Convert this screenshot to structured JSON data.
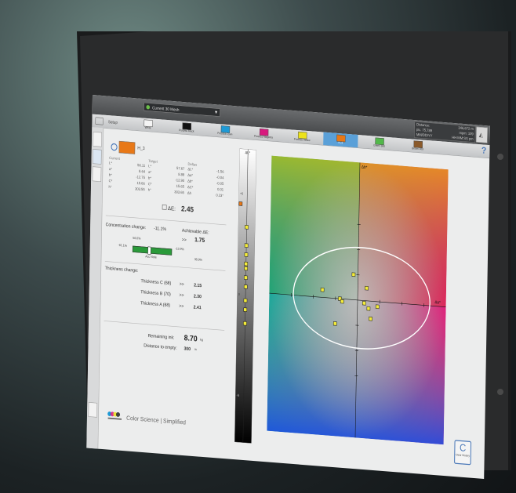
{
  "toolbar": {
    "combo_value": "Current 30 Mesh",
    "setup_label": "Setup",
    "distance_rows": [
      {
        "label": "Distance:",
        "value": "346,672 m"
      },
      {
        "label": "pic. 75,789",
        "value": "mpm: 109"
      },
      {
        "label": "MM/DD/YY",
        "value": "HH:MM:SS pm"
      }
    ]
  },
  "colorTabs": [
    {
      "label": "White",
      "color": "#f4f4f4"
    },
    {
      "label": "Process Black",
      "color": "#111111"
    },
    {
      "label": "Process Cyan",
      "color": "#1e9ad6"
    },
    {
      "label": "Process Magenta",
      "color": "#d8197e"
    },
    {
      "label": "Process Yellow",
      "color": "#ece21a"
    },
    {
      "label": "H_3",
      "color": "#e87817",
      "active": true
    },
    {
      "label": "Green 368",
      "color": "#52b84a"
    },
    {
      "label": "Brown 469",
      "color": "#8b5a2b"
    }
  ],
  "sample": {
    "name": "H_3",
    "color": "#e87817",
    "headers": [
      "Current",
      "Target",
      "Deltas"
    ],
    "current": [
      {
        "k": "L*",
        "v": "56.11"
      },
      {
        "k": "a*",
        "v": "8.64"
      },
      {
        "k": "b*",
        "v": "-12.75"
      },
      {
        "k": "C*",
        "v": "15.66"
      },
      {
        "k": "h°",
        "v": "303.55"
      }
    ],
    "target": [
      {
        "k": "L*",
        "v": "57.67"
      },
      {
        "k": "a*",
        "v": "8.88"
      },
      {
        "k": "b*",
        "v": "-12.90"
      },
      {
        "k": "C*",
        "v": "15.65"
      },
      {
        "k": "h°",
        "v": "303.65"
      }
    ],
    "deltas": [
      {
        "k": "ΔL*",
        "v": "-1.56"
      },
      {
        "k": "Δa*",
        "v": "-0.04"
      },
      {
        "k": "Δb*",
        "v": "-0.05"
      },
      {
        "k": "ΔC*",
        "v": "0.01"
      },
      {
        "k": "Δh",
        "v": "0.23°"
      }
    ],
    "delta_e_label": "ΔE:",
    "delta_e_value": "2.45"
  },
  "concentration": {
    "label": "Concentration change:",
    "value": "-11.1%",
    "achievable_label": "Achievable ΔE:",
    "achievable_value": "1.75",
    "arrow": ">>",
    "left_pct": "-61.1%",
    "mid_pct": "56.0%",
    "right_pct": "-13.9%",
    "far_pct": "38.9%",
    "bar_caption": "Acc Note",
    "fill_fraction": 0.42
  },
  "thickness": {
    "label": "Thickness change:",
    "arrow": ">>",
    "rows": [
      {
        "name": "Thickness C (68)",
        "value": "2.15"
      },
      {
        "name": "Thickness B (70)",
        "value": "2.30"
      },
      {
        "name": "Thickness A (68)",
        "value": "2.41"
      }
    ]
  },
  "ink": {
    "remaining_label": "Remaining ink:",
    "remaining_value": "8.70",
    "remaining_unit": "kg",
    "empty_label": "Distance to empty:",
    "empty_value": "300",
    "empty_unit": "m"
  },
  "brand": {
    "text": "Color Science | Simplified"
  },
  "clear_button": {
    "icon": "C",
    "label": "Clear History"
  },
  "chart": {
    "l_axis_label": "ΔL*",
    "b_axis_label": "Δb*",
    "a_axis_label": "Δa*",
    "l_ticks": [
      "+5",
      "0",
      "-5"
    ],
    "ellipse_color": "#ffffff"
  },
  "chart_data": {
    "type": "scatter",
    "title": "",
    "xlabel": "Δa*",
    "ylabel": "Δb*",
    "points": [
      {
        "x": -0.1,
        "y": 0.5
      },
      {
        "x": 0.2,
        "y": 0.25
      },
      {
        "x": -0.8,
        "y": 0.15
      },
      {
        "x": -0.4,
        "y": 0.0
      },
      {
        "x": -0.35,
        "y": -0.05
      },
      {
        "x": 0.15,
        "y": -0.05
      },
      {
        "x": 0.25,
        "y": -0.15
      },
      {
        "x": 0.45,
        "y": -0.1
      },
      {
        "x": 0.3,
        "y": -0.35
      },
      {
        "x": -0.5,
        "y": -0.5
      }
    ],
    "l_points": [
      0.75,
      0.55,
      0.45,
      0.35,
      0.3,
      0.2,
      0.1,
      -0.05,
      -0.15,
      -0.3
    ],
    "current_l": 1.0
  }
}
